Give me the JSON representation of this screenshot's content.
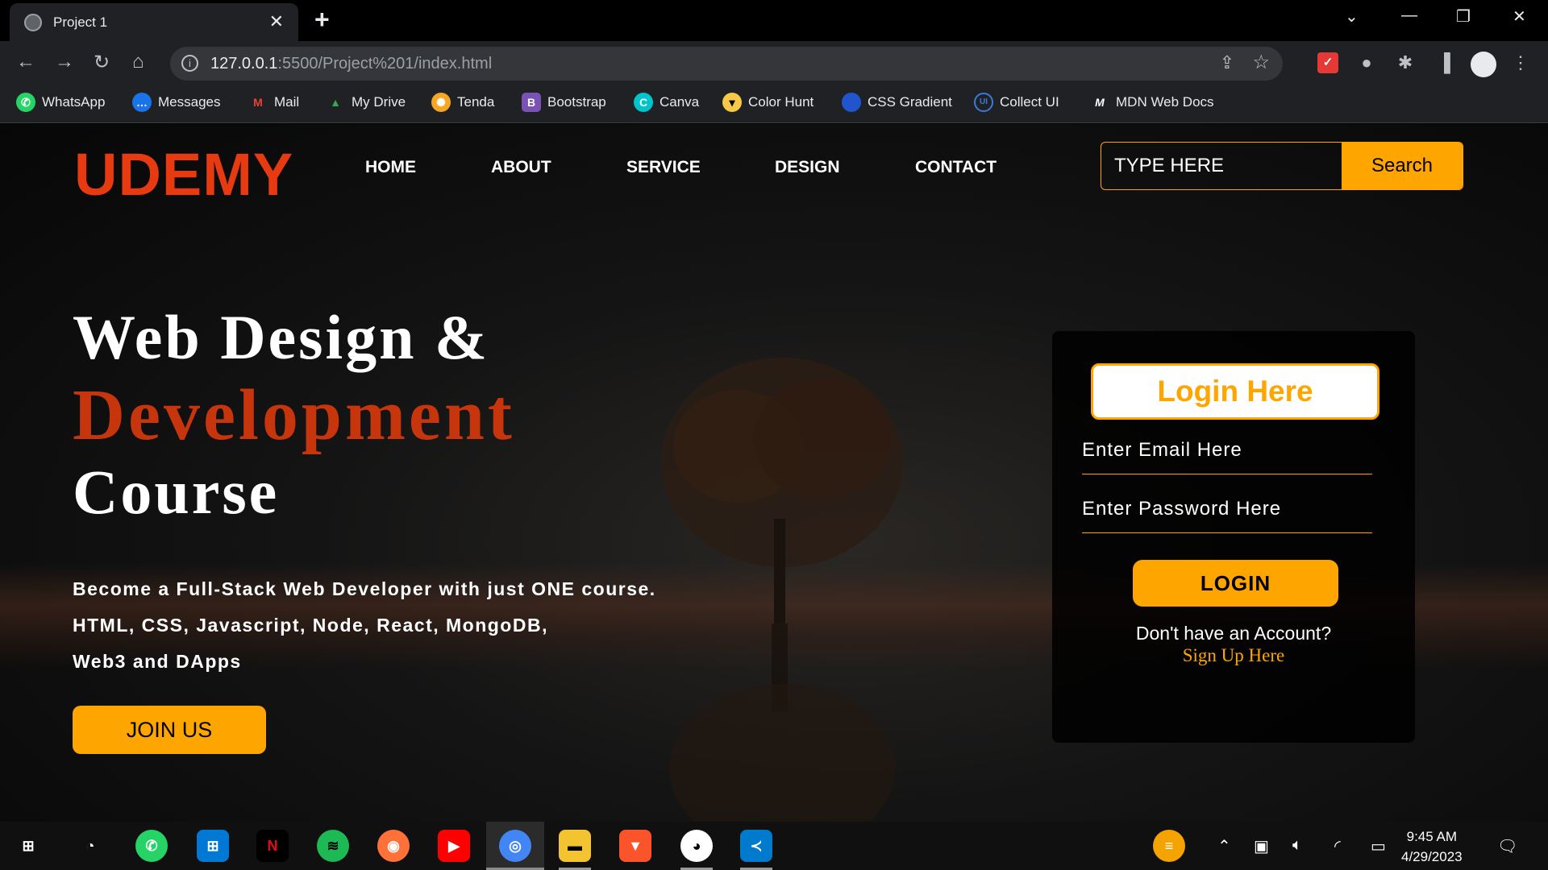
{
  "browser": {
    "tab_title": "Project 1",
    "url_host": "127.0.0.1",
    "url_rest": ":5500/Project%201/index.html",
    "bookmarks": [
      {
        "label": "WhatsApp",
        "icon": "whatsapp-icon",
        "color": "#25d366"
      },
      {
        "label": "Messages",
        "icon": "messages-icon",
        "color": "#1a73e8"
      },
      {
        "label": "Mail",
        "icon": "gmail-icon",
        "color": "#ea4335"
      },
      {
        "label": "My Drive",
        "icon": "drive-icon",
        "color": "#34a853"
      },
      {
        "label": "Tenda",
        "icon": "tenda-icon",
        "color": "#f5a623"
      },
      {
        "label": "Bootstrap",
        "icon": "bootstrap-icon",
        "color": "#7952b3"
      },
      {
        "label": "Canva",
        "icon": "canva-icon",
        "color": "#00c4cc"
      },
      {
        "label": "Color Hunt",
        "icon": "colorhunt-icon",
        "color": "#f7c948"
      },
      {
        "label": "CSS Gradient",
        "icon": "cssgradient-icon",
        "color": "#2155cd"
      },
      {
        "label": "Collect UI",
        "icon": "collectui-icon",
        "color": "#3a7bd5"
      },
      {
        "label": "MDN Web Docs",
        "icon": "mdn-icon",
        "color": "#ffffff"
      }
    ]
  },
  "site": {
    "logo": "UDEMY",
    "nav": [
      "HOME",
      "ABOUT",
      "SERVICE",
      "DESIGN",
      "CONTACT"
    ],
    "search_placeholder": "TYPE HERE",
    "search_button": "Search",
    "hero_line1": "Web Design &",
    "hero_line2": "Development",
    "hero_line3": "Course",
    "para_line1": "Become a Full-Stack Web Developer with just ONE course.",
    "para_line2": "HTML, CSS, Javascript, Node, React, MongoDB,",
    "para_line3": "Web3 and DApps",
    "join_button": "JOIN US",
    "login": {
      "title": "Login Here",
      "email_placeholder": "Enter Email Here",
      "password_placeholder": "Enter Password Here",
      "button": "LOGIN",
      "no_account": "Don't have an Account?",
      "signup_link": "Sign Up Here"
    }
  },
  "taskbar": {
    "time": "9:45 AM",
    "date": "4/29/2023"
  },
  "colors": {
    "accent": "#ffa500",
    "brand_red": "#e83a10",
    "hero_red": "#c7350c"
  }
}
